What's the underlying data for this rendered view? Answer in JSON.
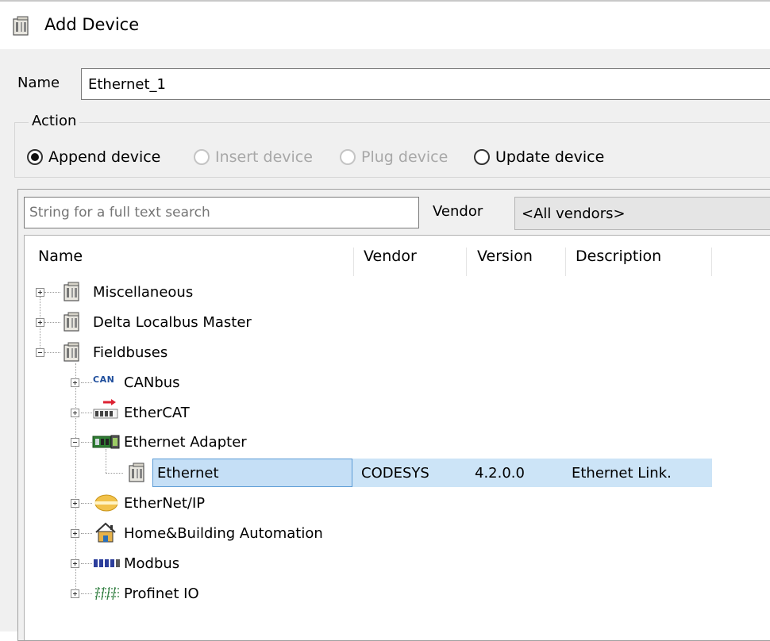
{
  "window": {
    "title": "Add Device",
    "icon": "device-module-icon"
  },
  "name_field": {
    "label": "Name",
    "value": "Ethernet_1"
  },
  "action": {
    "legend": "Action",
    "options": [
      {
        "label": "Append device",
        "checked": true,
        "enabled": true
      },
      {
        "label": "Insert device",
        "checked": false,
        "enabled": false
      },
      {
        "label": "Plug device",
        "checked": false,
        "enabled": false
      },
      {
        "label": "Update device",
        "checked": false,
        "enabled": true
      }
    ]
  },
  "search": {
    "placeholder": "String for a full text search"
  },
  "vendor": {
    "label": "Vendor",
    "selected": "<All vendors>"
  },
  "table": {
    "columns": [
      "Name",
      "Vendor",
      "Version",
      "Description"
    ],
    "tree": [
      {
        "label": "Miscellaneous",
        "expander": "plus",
        "icon": "device-module-icon"
      },
      {
        "label": "Delta Localbus Master",
        "expander": "plus",
        "icon": "device-module-icon"
      },
      {
        "label": "Fieldbuses",
        "expander": "minus",
        "icon": "device-module-icon",
        "children": [
          {
            "label": "CANbus",
            "expander": "plus",
            "icon": "canbus-icon",
            "icon_text": "CAN"
          },
          {
            "label": "EtherCAT",
            "expander": "plus",
            "icon": "ethercat-icon"
          },
          {
            "label": "Ethernet Adapter",
            "expander": "minus",
            "icon": "ethernet-adapter-icon",
            "children": [
              {
                "label": "Ethernet",
                "icon": "device-module-icon",
                "selected": true,
                "vendor": "CODESYS",
                "version": "4.2.0.0",
                "description": "Ethernet Link."
              }
            ]
          },
          {
            "label": "EtherNet/IP",
            "expander": "plus",
            "icon": "ethernet-ip-icon"
          },
          {
            "label": "Home&Building Automation",
            "expander": "plus",
            "icon": "home-icon"
          },
          {
            "label": "Modbus",
            "expander": "plus",
            "icon": "modbus-icon"
          },
          {
            "label": "Profinet IO",
            "expander": "plus",
            "icon": "profinet-icon"
          }
        ]
      }
    ]
  }
}
